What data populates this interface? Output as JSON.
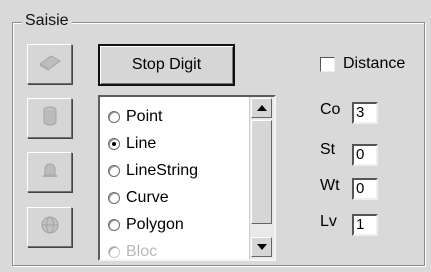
{
  "group": {
    "title": "Saisie"
  },
  "toolbar": {
    "buttons": [
      {
        "icon": "eraser-icon"
      },
      {
        "icon": "cylinder-icon"
      },
      {
        "icon": "bell-icon"
      },
      {
        "icon": "globe-icon"
      }
    ]
  },
  "stop_button": {
    "label": "Stop Digit"
  },
  "geometry_list": {
    "items": [
      {
        "label": "Point",
        "checked": false
      },
      {
        "label": "Line",
        "checked": true
      },
      {
        "label": "LineString",
        "checked": false
      },
      {
        "label": "Curve",
        "checked": false
      },
      {
        "label": "Polygon",
        "checked": false
      },
      {
        "label": "Bloc",
        "checked": false
      }
    ]
  },
  "distance": {
    "label": "Distance",
    "checked": false
  },
  "fields": [
    {
      "label": "Co",
      "value": "3"
    },
    {
      "label": "St",
      "value": "0"
    },
    {
      "label": "Wt",
      "value": "0"
    },
    {
      "label": "Lv",
      "value": "1"
    }
  ]
}
